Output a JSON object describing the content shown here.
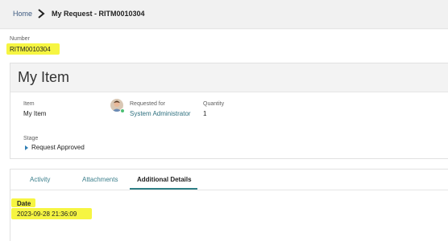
{
  "breadcrumb": {
    "home": "Home",
    "current": "My Request - RITM0010304"
  },
  "record": {
    "number_label": "Number",
    "number_value": "RITM0010304"
  },
  "item_card": {
    "title": "My Item",
    "item_label": "Item",
    "item_value": "My Item",
    "requested_for_label": "Requested for",
    "requested_for_value": "System Administrator",
    "quantity_label": "Quantity",
    "quantity_value": "1",
    "stage_label": "Stage",
    "stage_value": "Request Approved"
  },
  "tabs": [
    {
      "label": "Activity"
    },
    {
      "label": "Attachments"
    },
    {
      "label": "Additional Details"
    }
  ],
  "details": {
    "date_label": "Date",
    "date_value": "2023-09-28 21:36:09"
  },
  "colors": {
    "highlight": "#f6f542",
    "link": "#2d6f7e",
    "active_tab_underline": "#2f7f86",
    "presence_online": "#4bbf73"
  },
  "icons": [
    "chevron-right-icon",
    "user-avatar",
    "presence-dot-icon",
    "caret-right-icon"
  ]
}
